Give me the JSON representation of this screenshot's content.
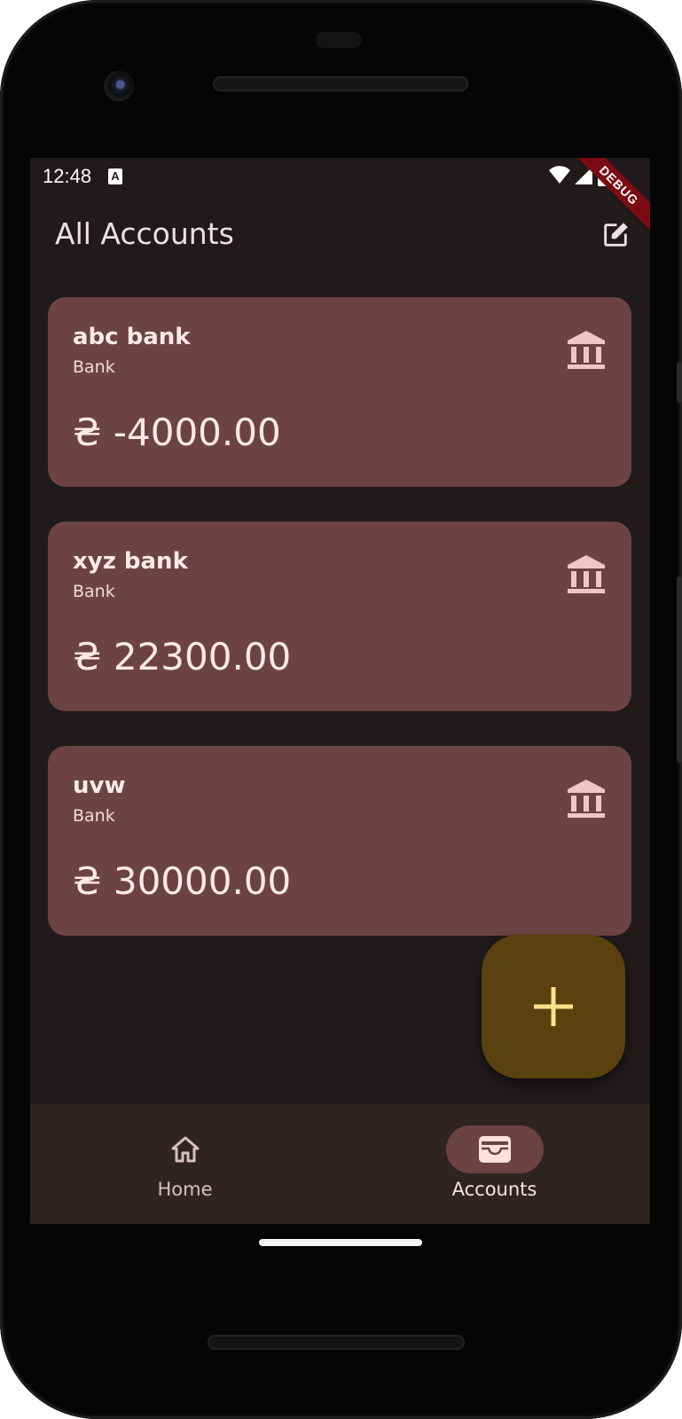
{
  "status_bar": {
    "time": "12:48",
    "notification_icon": "a-icon",
    "icons": [
      "wifi-icon",
      "signal-icon",
      "battery-icon"
    ]
  },
  "debug_banner": "DEBUG",
  "app_bar": {
    "title": "All Accounts",
    "action_icon": "edit-icon"
  },
  "accounts": [
    {
      "name": "abc bank",
      "type": "Bank",
      "balance": "₴ -4000.00",
      "icon": "bank-icon"
    },
    {
      "name": "xyz bank",
      "type": "Bank",
      "balance": "₴ 22300.00",
      "icon": "bank-icon"
    },
    {
      "name": "uvw",
      "type": "Bank",
      "balance": "₴ 30000.00",
      "icon": "bank-icon"
    }
  ],
  "fab": {
    "icon": "plus-icon"
  },
  "bottom_nav": {
    "items": [
      {
        "label": "Home",
        "icon": "home-icon",
        "active": false
      },
      {
        "label": "Accounts",
        "icon": "wallet-icon",
        "active": true
      }
    ]
  },
  "colors": {
    "background": "#201a1b",
    "card": "#6b4342",
    "fab": "#5a4210",
    "fab_icon": "#ffe08a",
    "nav_bar": "#302324",
    "nav_active_pill": "#6b4342",
    "debug_ribbon": "#7c0b14"
  }
}
